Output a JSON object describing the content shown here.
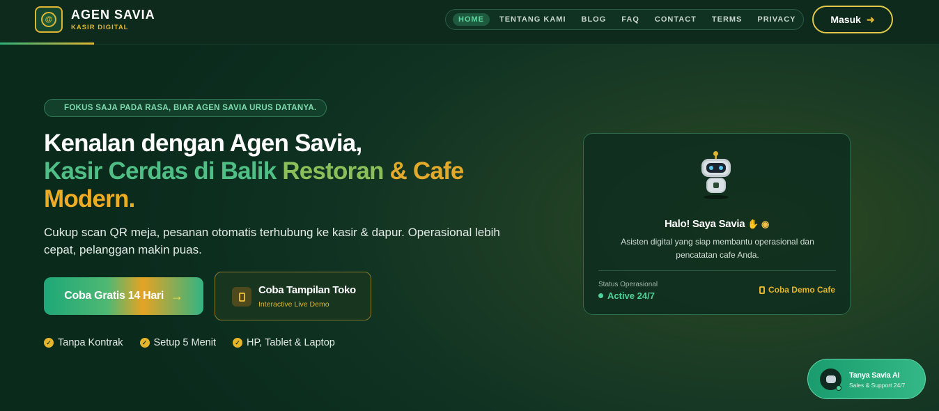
{
  "header": {
    "brand_name": "AGEN SAVIA",
    "brand_sub": "KASIR DIGITAL",
    "nav": [
      "HOME",
      "TENTANG KAMI",
      "BLOG",
      "FAQ",
      "CONTACT",
      "TERMS",
      "PRIVACY"
    ],
    "active_nav": "HOME",
    "login_label": "Masuk"
  },
  "hero": {
    "tagline": "FOKUS SAJA PADA RASA, BIAR AGEN SAVIA URUS DATANYA.",
    "headline_line1": "Kenalan dengan Agen Savia,",
    "headline_line2_a": "Kasir Cerdas di Balik ",
    "headline_line2_b": "Restoran ",
    "headline_line2_c": "& Cafe",
    "headline_line3": "Modern.",
    "description": "Cukup scan QR meja, pesanan otomatis terhubung ke kasir & dapur. Operasional lebih cepat, pelanggan makin puas.",
    "cta_primary": "Coba Gratis 14 Hari",
    "cta_secondary_title": "Coba Tampilan Toko",
    "cta_secondary_sub": "Interactive Live Demo",
    "features": [
      "Tanpa Kontrak",
      "Setup 5 Menit",
      "HP, Tablet & Laptop"
    ]
  },
  "card": {
    "title": "Halo! Saya Savia",
    "description": "Asisten digital yang siap membantu operasional dan pencatatan cafe Anda.",
    "status_label": "Status Operasional",
    "status_value": "Active 24/7",
    "demo_link": "Coba Demo Cafe"
  },
  "chat_widget": {
    "title": "Tanya Savia AI",
    "subtitle": "Sales & Support 24/7"
  },
  "colors": {
    "accent_green": "#4fbf86",
    "accent_gold": "#e0b534",
    "bg_dark": "#0d2a1c"
  }
}
